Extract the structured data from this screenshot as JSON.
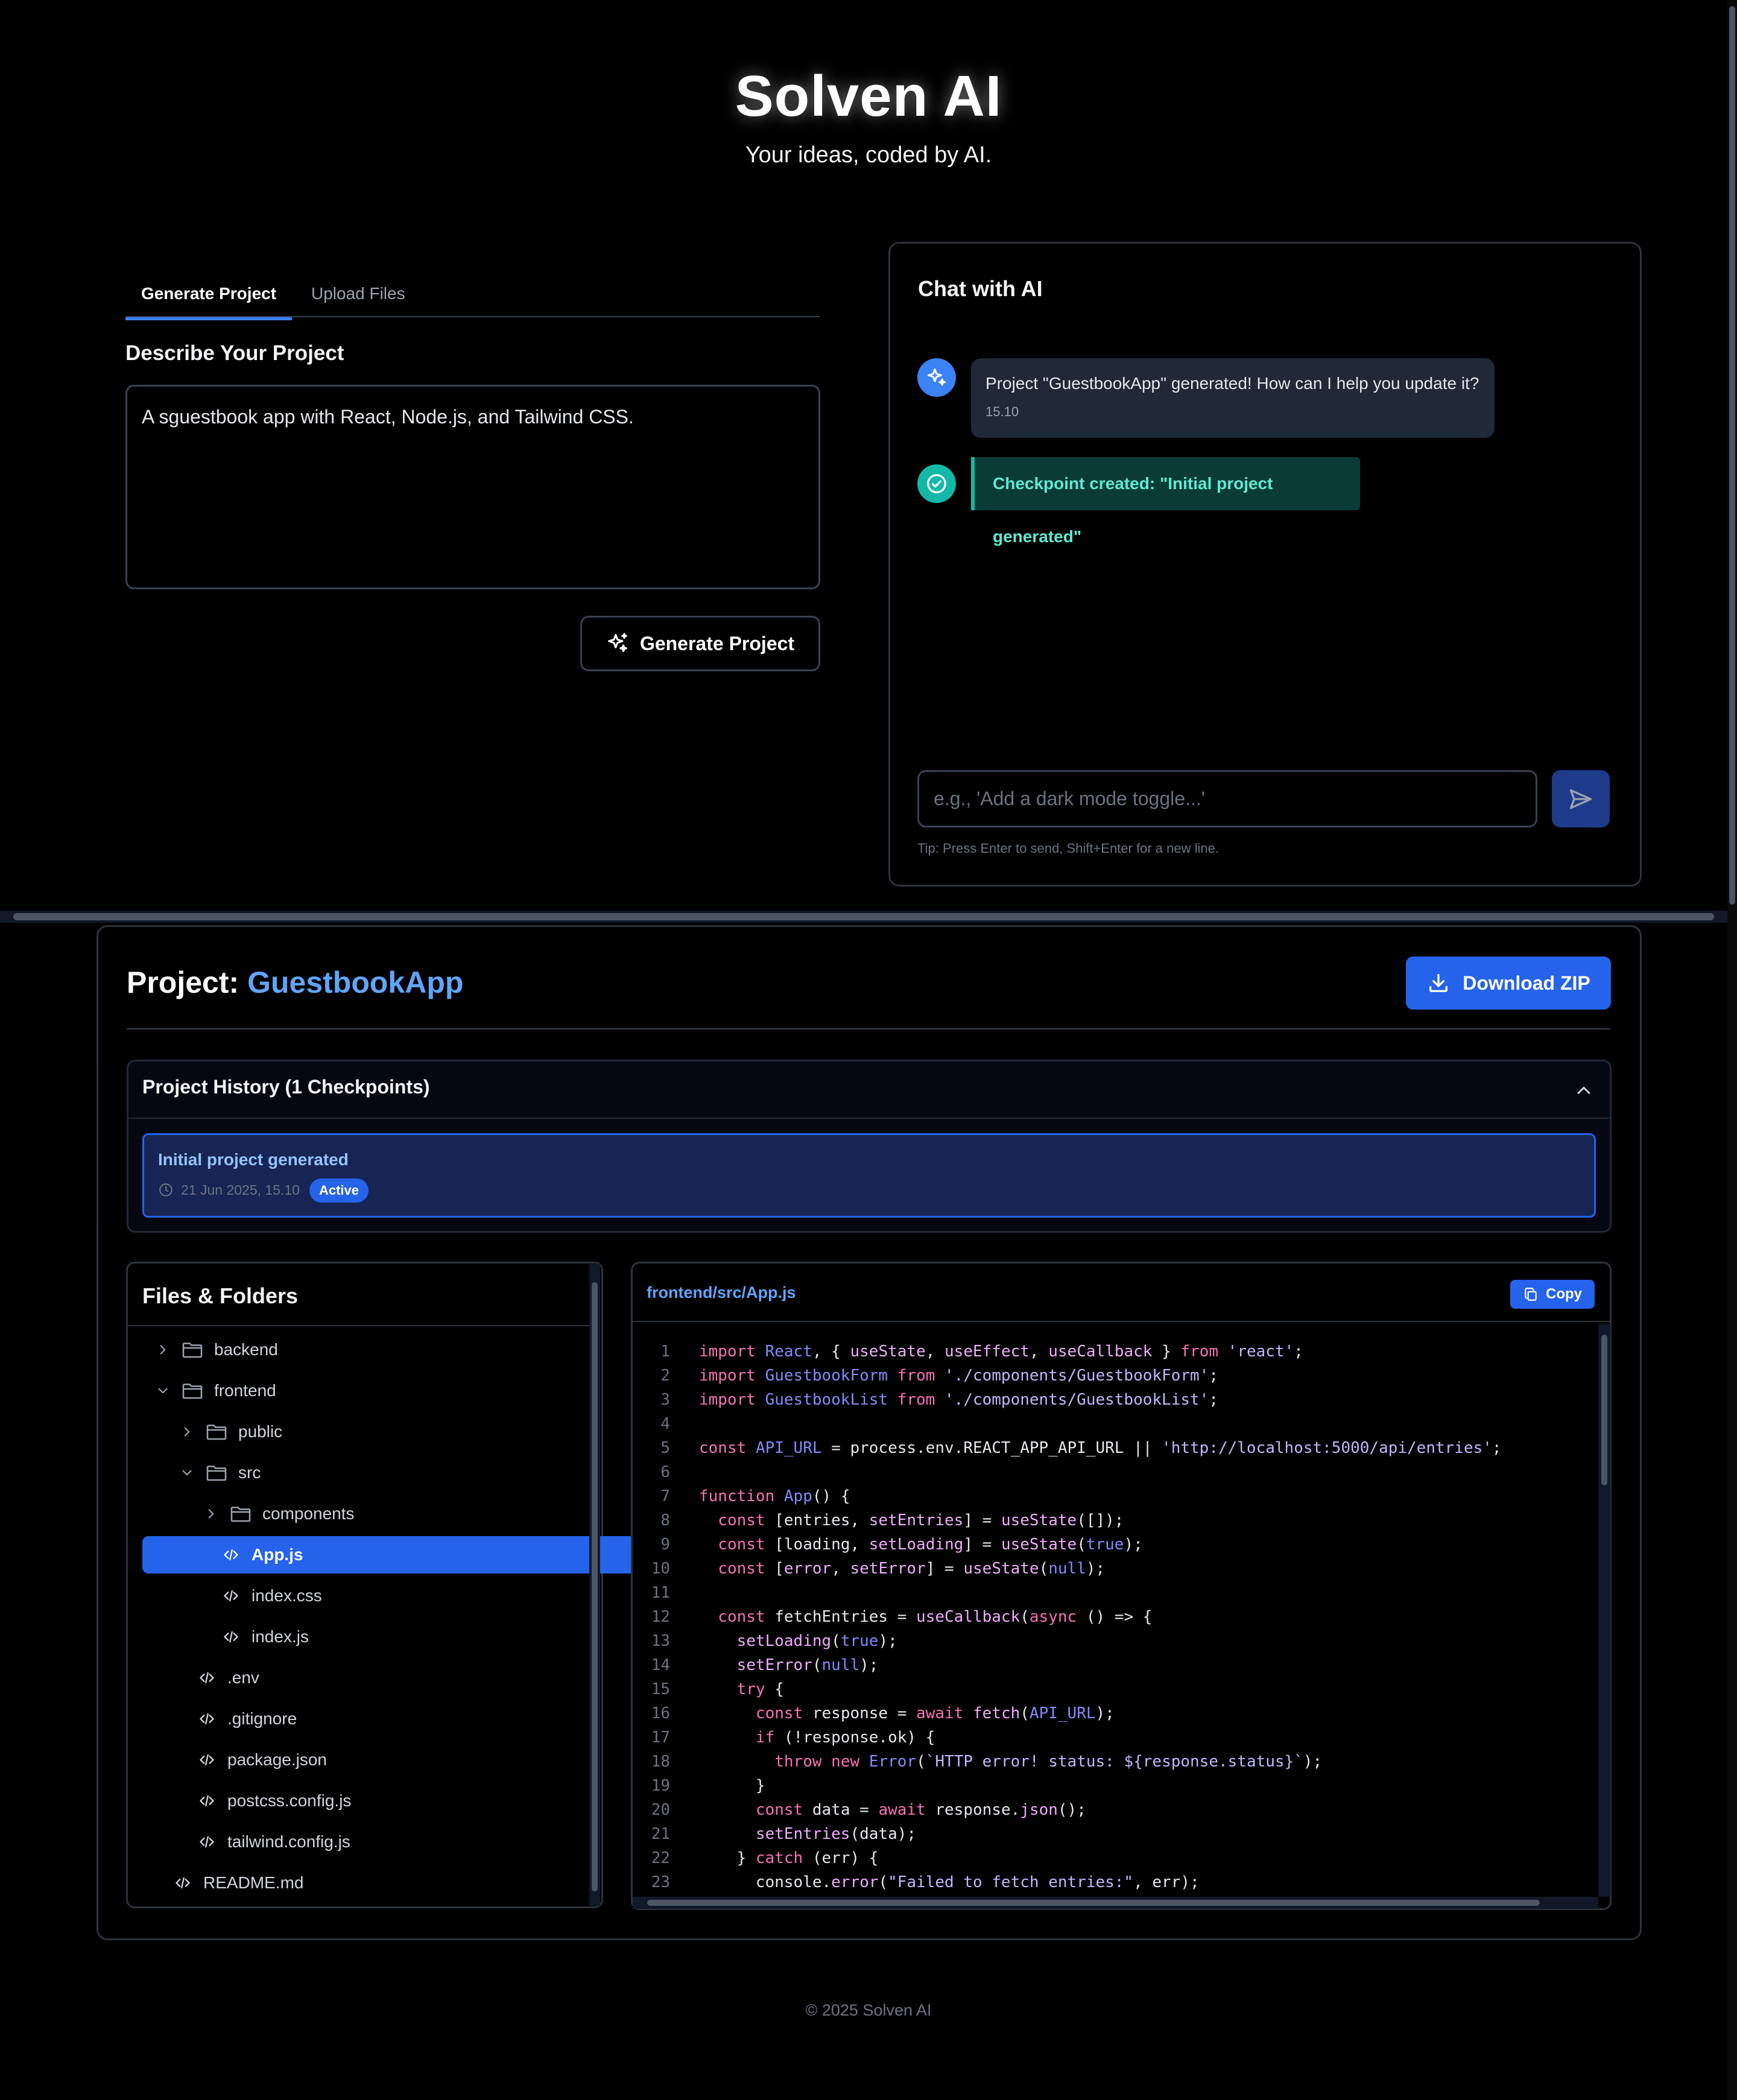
{
  "header": {
    "brand": "Solven AI",
    "tagline": "Your ideas, coded by AI."
  },
  "tabs": [
    {
      "label": "Generate Project",
      "active": true
    },
    {
      "label": "Upload Files",
      "active": false
    }
  ],
  "generate": {
    "section_title": "Describe Your Project",
    "description": "A sguestbook app with React, Node.js, and Tailwind CSS.",
    "button_label": "Generate Project"
  },
  "chat": {
    "title": "Chat with AI",
    "messages": [
      {
        "type": "ai",
        "text": "Project \"GuestbookApp\" generated! How can I help you update it?",
        "time": "15.10"
      },
      {
        "type": "checkpoint",
        "text": "Checkpoint created: \"Initial project generated\""
      }
    ],
    "input_placeholder": "e.g., 'Add a dark mode toggle...'",
    "tip": "Tip: Press Enter to send, Shift+Enter for a new line."
  },
  "project": {
    "title_prefix": "Project:",
    "name": "GuestbookApp",
    "download_label": "Download ZIP",
    "history": {
      "title": "Project History (1 Checkpoints)",
      "items": [
        {
          "title": "Initial project generated",
          "date": "21 Jun 2025, 15.10",
          "badge": "Active"
        }
      ]
    },
    "files": {
      "title": "Files & Folders",
      "tree": [
        {
          "name": "backend",
          "kind": "folder",
          "depth": 0,
          "expanded": false
        },
        {
          "name": "frontend",
          "kind": "folder",
          "depth": 0,
          "expanded": true
        },
        {
          "name": "public",
          "kind": "folder",
          "depth": 1,
          "expanded": false
        },
        {
          "name": "src",
          "kind": "folder",
          "depth": 1,
          "expanded": true
        },
        {
          "name": "components",
          "kind": "folder",
          "depth": 2,
          "expanded": false
        },
        {
          "name": "App.js",
          "kind": "file",
          "depth": 2,
          "selected": true
        },
        {
          "name": "index.css",
          "kind": "file",
          "depth": 2
        },
        {
          "name": "index.js",
          "kind": "file",
          "depth": 2
        },
        {
          "name": ".env",
          "kind": "file",
          "depth": 1
        },
        {
          "name": ".gitignore",
          "kind": "file",
          "depth": 1
        },
        {
          "name": "package.json",
          "kind": "file",
          "depth": 1
        },
        {
          "name": "postcss.config.js",
          "kind": "file",
          "depth": 1
        },
        {
          "name": "tailwind.config.js",
          "kind": "file",
          "depth": 1
        },
        {
          "name": "README.md",
          "kind": "file",
          "depth": 0
        }
      ]
    },
    "editor": {
      "path": "frontend/src/App.js",
      "copy_label": "Copy",
      "lines": [
        "import React, { useState, useEffect, useCallback } from 'react';",
        "import GuestbookForm from './components/GuestbookForm';",
        "import GuestbookList from './components/GuestbookList';",
        "",
        "const API_URL = process.env.REACT_APP_API_URL || 'http://localhost:5000/api/entries';",
        "",
        "function App() {",
        "  const [entries, setEntries] = useState([]);",
        "  const [loading, setLoading] = useState(true);",
        "  const [error, setError] = useState(null);",
        "",
        "  const fetchEntries = useCallback(async () => {",
        "    setLoading(true);",
        "    setError(null);",
        "    try {",
        "      const response = await fetch(API_URL);",
        "      if (!response.ok) {",
        "        throw new Error(`HTTP error! status: ${response.status}`);",
        "      }",
        "      const data = await response.json();",
        "      setEntries(data);",
        "    } catch (err) {",
        "      console.error(\"Failed to fetch entries:\", err);"
      ]
    }
  },
  "footer": "© 2025 Solven AI",
  "colors": {
    "accent": "#2563eb",
    "accent_light": "#60a5fa",
    "teal": "#14b8a6",
    "background": "#000000"
  }
}
